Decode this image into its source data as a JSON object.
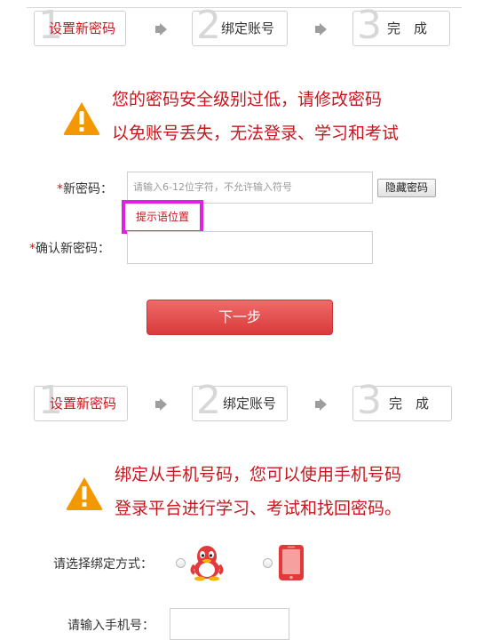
{
  "steps_top": {
    "step1": {
      "num": "1",
      "label": "设置新密码"
    },
    "step2": {
      "num": "2",
      "label": "绑定账号"
    },
    "step3": {
      "num": "3",
      "label": "完　成"
    }
  },
  "notice1": {
    "line1": "您的密码安全级别过低，请修改密码",
    "line2": "以免账号丢失，无法登录、学习和考试"
  },
  "form": {
    "required_mark": "*",
    "new_password_label": "新密码：",
    "new_password_placeholder": "请输入6-12位字符，不允许输入符号",
    "hide_password_button": "隐藏密码",
    "hint_text": "提示语位置",
    "confirm_password_label": "确认新密码：",
    "next_button": "下一步"
  },
  "steps_bottom": {
    "step1": {
      "num": "1",
      "label": "设置新密码"
    },
    "step2": {
      "num": "2",
      "label": "绑定账号"
    },
    "step3": {
      "num": "3",
      "label": "完　成"
    }
  },
  "notice2": {
    "line1": "绑定从手机号码，您可以使用手机号码",
    "line2": "登录平台进行学习、考试和找回密码。"
  },
  "bind": {
    "method_label": "请选择绑定方式：",
    "phone_label": "请输入手机号："
  },
  "colors": {
    "accent": "#c8161d",
    "warning": "#f39800",
    "button": "#e04a4a",
    "hint_border": "#e020e0"
  }
}
